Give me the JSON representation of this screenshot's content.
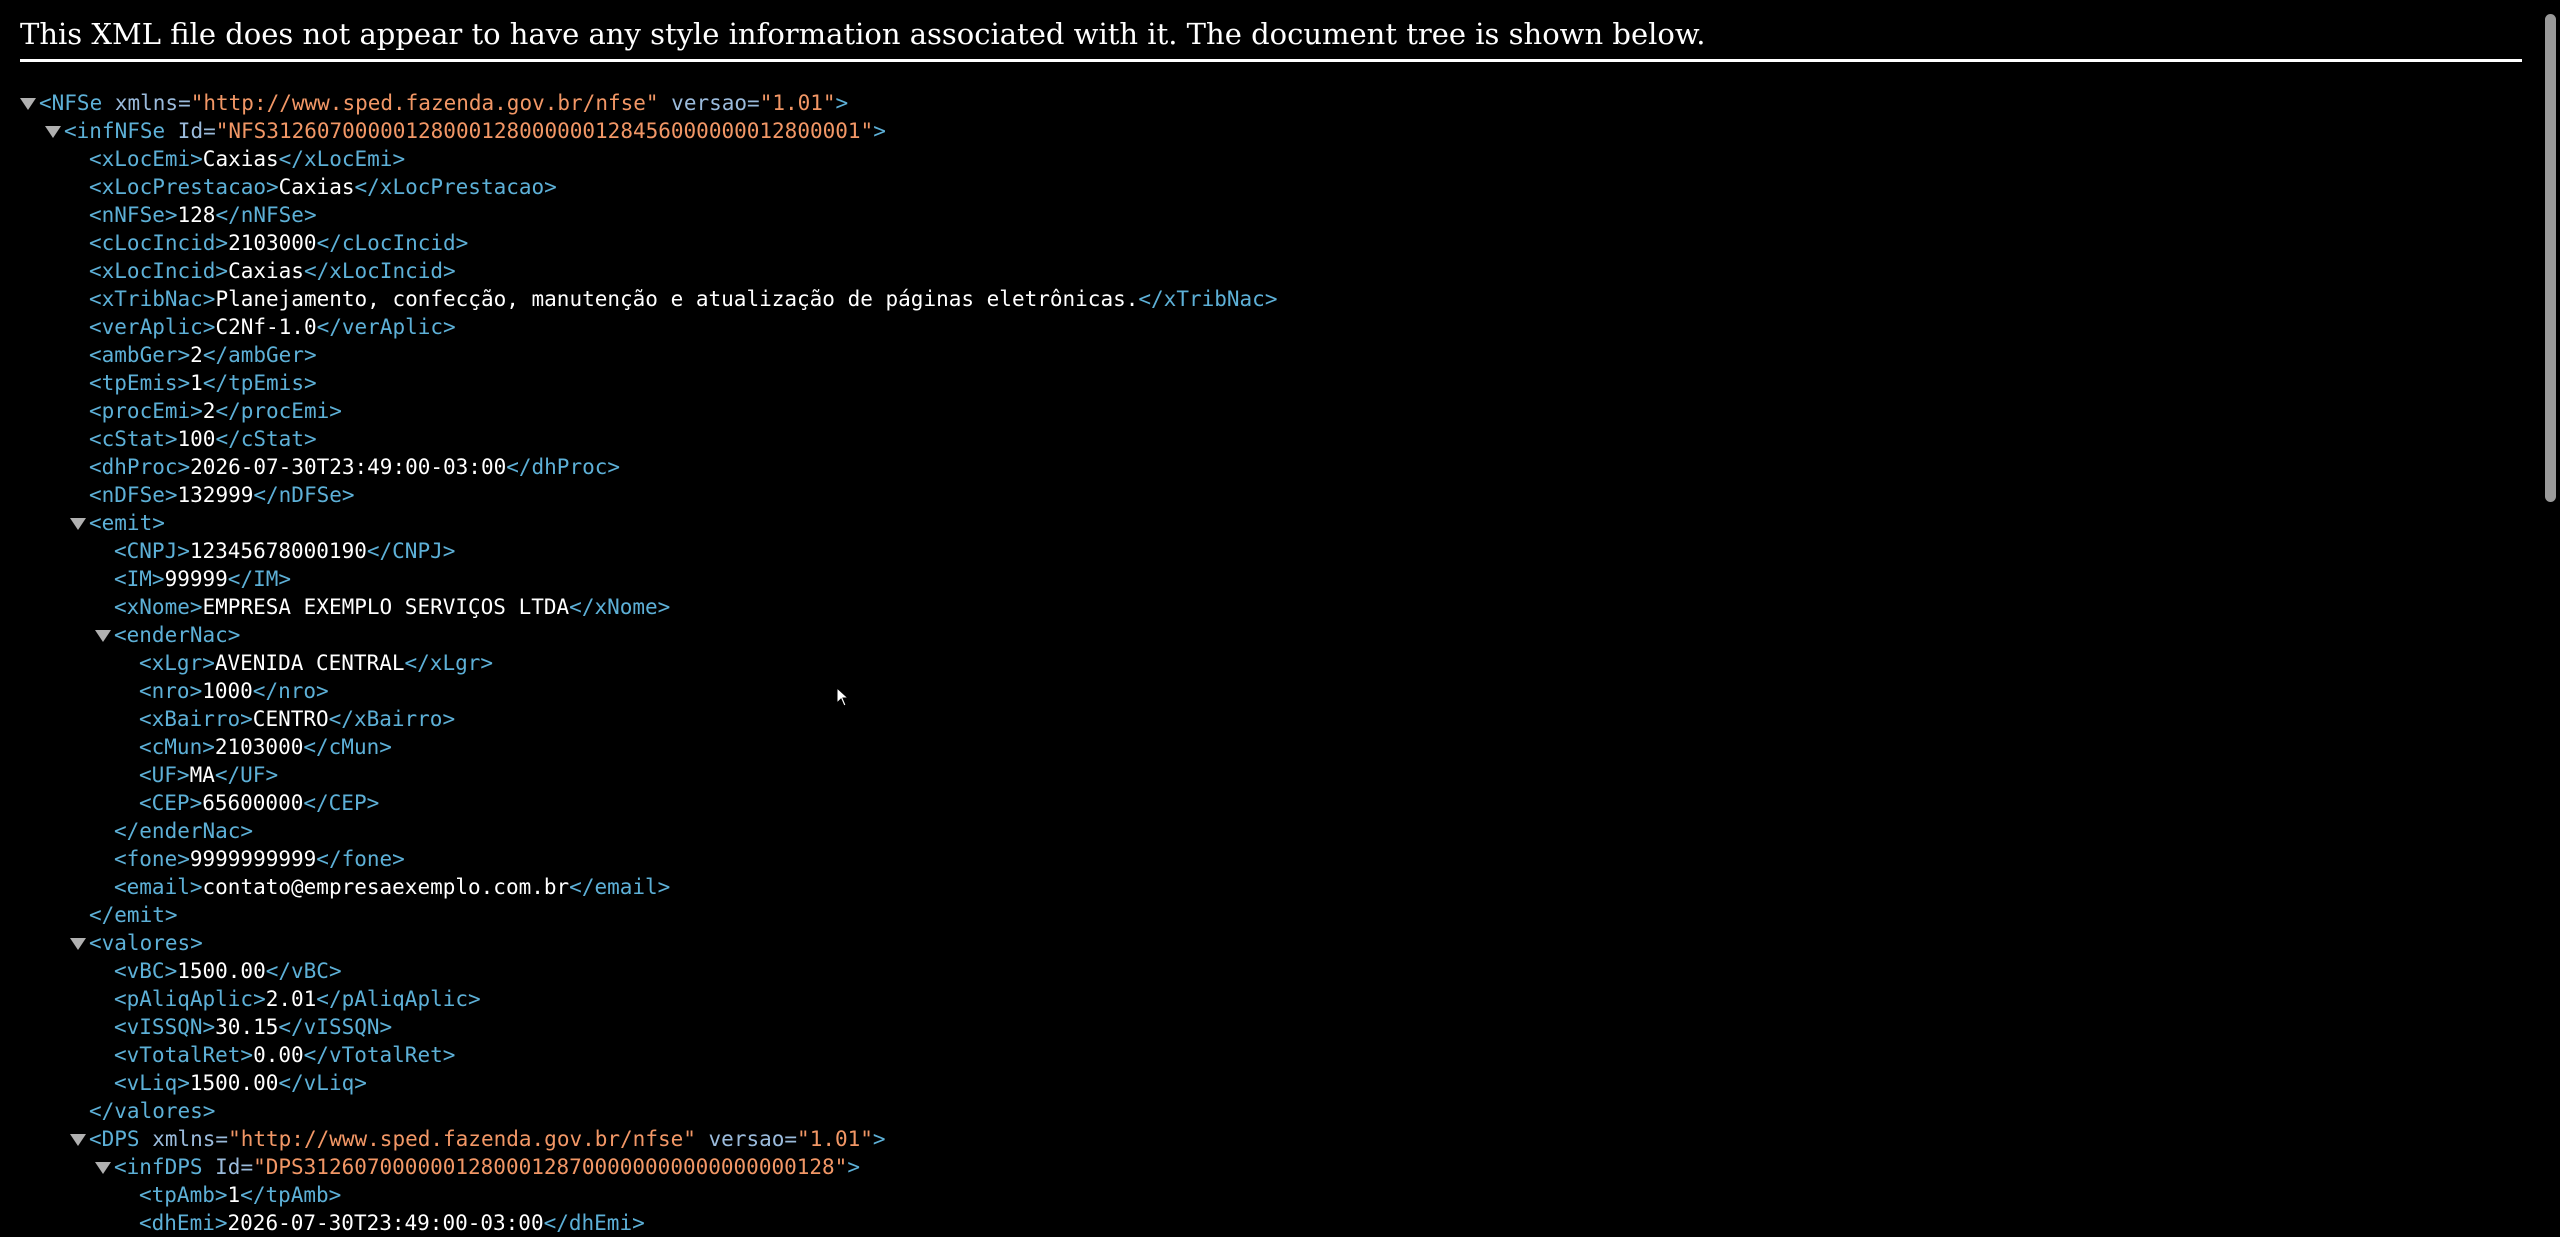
{
  "notice": "This XML file does not appear to have any style information associated with it. The document tree is shown below.",
  "lines": [
    {
      "indent": 0,
      "toggle": true,
      "parts": [
        {
          "t": "tg",
          "v": "<NFSe"
        },
        {
          "t": "an",
          "v": " xmlns="
        },
        {
          "t": "av",
          "v": "\"http://www.sped.fazenda.gov.br/nfse\""
        },
        {
          "t": "an",
          "v": " versao="
        },
        {
          "t": "av",
          "v": "\"1.01\""
        },
        {
          "t": "tg",
          "v": ">"
        }
      ]
    },
    {
      "indent": 1,
      "toggle": true,
      "parts": [
        {
          "t": "tg",
          "v": "<infNFSe"
        },
        {
          "t": "an",
          "v": " Id="
        },
        {
          "t": "av",
          "v": "\"NFS31260700000128000128000000128456000000012800001\""
        },
        {
          "t": "tg",
          "v": ">"
        }
      ]
    },
    {
      "indent": 2,
      "parts": [
        {
          "t": "tg",
          "v": "<xLocEmi>"
        },
        {
          "t": "tx",
          "v": "Caxias"
        },
        {
          "t": "tg",
          "v": "</xLocEmi>"
        }
      ]
    },
    {
      "indent": 2,
      "parts": [
        {
          "t": "tg",
          "v": "<xLocPrestacao>"
        },
        {
          "t": "tx",
          "v": "Caxias"
        },
        {
          "t": "tg",
          "v": "</xLocPrestacao>"
        }
      ]
    },
    {
      "indent": 2,
      "parts": [
        {
          "t": "tg",
          "v": "<nNFSe>"
        },
        {
          "t": "tx",
          "v": "128"
        },
        {
          "t": "tg",
          "v": "</nNFSe>"
        }
      ]
    },
    {
      "indent": 2,
      "parts": [
        {
          "t": "tg",
          "v": "<cLocIncid>"
        },
        {
          "t": "tx",
          "v": "2103000"
        },
        {
          "t": "tg",
          "v": "</cLocIncid>"
        }
      ]
    },
    {
      "indent": 2,
      "parts": [
        {
          "t": "tg",
          "v": "<xLocIncid>"
        },
        {
          "t": "tx",
          "v": "Caxias"
        },
        {
          "t": "tg",
          "v": "</xLocIncid>"
        }
      ]
    },
    {
      "indent": 2,
      "parts": [
        {
          "t": "tg",
          "v": "<xTribNac>"
        },
        {
          "t": "tx",
          "v": "Planejamento, confecção, manutenção e atualização de páginas eletrônicas."
        },
        {
          "t": "tg",
          "v": "</xTribNac>"
        }
      ]
    },
    {
      "indent": 2,
      "parts": [
        {
          "t": "tg",
          "v": "<verAplic>"
        },
        {
          "t": "tx",
          "v": "C2Nf-1.0"
        },
        {
          "t": "tg",
          "v": "</verAplic>"
        }
      ]
    },
    {
      "indent": 2,
      "parts": [
        {
          "t": "tg",
          "v": "<ambGer>"
        },
        {
          "t": "tx",
          "v": "2"
        },
        {
          "t": "tg",
          "v": "</ambGer>"
        }
      ]
    },
    {
      "indent": 2,
      "parts": [
        {
          "t": "tg",
          "v": "<tpEmis>"
        },
        {
          "t": "tx",
          "v": "1"
        },
        {
          "t": "tg",
          "v": "</tpEmis>"
        }
      ]
    },
    {
      "indent": 2,
      "parts": [
        {
          "t": "tg",
          "v": "<procEmi>"
        },
        {
          "t": "tx",
          "v": "2"
        },
        {
          "t": "tg",
          "v": "</procEmi>"
        }
      ]
    },
    {
      "indent": 2,
      "parts": [
        {
          "t": "tg",
          "v": "<cStat>"
        },
        {
          "t": "tx",
          "v": "100"
        },
        {
          "t": "tg",
          "v": "</cStat>"
        }
      ]
    },
    {
      "indent": 2,
      "parts": [
        {
          "t": "tg",
          "v": "<dhProc>"
        },
        {
          "t": "tx",
          "v": "2026-07-30T23:49:00-03:00"
        },
        {
          "t": "tg",
          "v": "</dhProc>"
        }
      ]
    },
    {
      "indent": 2,
      "parts": [
        {
          "t": "tg",
          "v": "<nDFSe>"
        },
        {
          "t": "tx",
          "v": "132999"
        },
        {
          "t": "tg",
          "v": "</nDFSe>"
        }
      ]
    },
    {
      "indent": 2,
      "toggle": true,
      "parts": [
        {
          "t": "tg",
          "v": "<emit>"
        }
      ]
    },
    {
      "indent": 3,
      "parts": [
        {
          "t": "tg",
          "v": "<CNPJ>"
        },
        {
          "t": "tx",
          "v": "12345678000190"
        },
        {
          "t": "tg",
          "v": "</CNPJ>"
        }
      ]
    },
    {
      "indent": 3,
      "parts": [
        {
          "t": "tg",
          "v": "<IM>"
        },
        {
          "t": "tx",
          "v": "99999"
        },
        {
          "t": "tg",
          "v": "</IM>"
        }
      ]
    },
    {
      "indent": 3,
      "parts": [
        {
          "t": "tg",
          "v": "<xNome>"
        },
        {
          "t": "tx",
          "v": "EMPRESA EXEMPLO SERVIÇOS LTDA"
        },
        {
          "t": "tg",
          "v": "</xNome>"
        }
      ]
    },
    {
      "indent": 3,
      "toggle": true,
      "parts": [
        {
          "t": "tg",
          "v": "<enderNac>"
        }
      ]
    },
    {
      "indent": 4,
      "parts": [
        {
          "t": "tg",
          "v": "<xLgr>"
        },
        {
          "t": "tx",
          "v": "AVENIDA CENTRAL"
        },
        {
          "t": "tg",
          "v": "</xLgr>"
        }
      ]
    },
    {
      "indent": 4,
      "parts": [
        {
          "t": "tg",
          "v": "<nro>"
        },
        {
          "t": "tx",
          "v": "1000"
        },
        {
          "t": "tg",
          "v": "</nro>"
        }
      ]
    },
    {
      "indent": 4,
      "parts": [
        {
          "t": "tg",
          "v": "<xBairro>"
        },
        {
          "t": "tx",
          "v": "CENTRO"
        },
        {
          "t": "tg",
          "v": "</xBairro>"
        }
      ]
    },
    {
      "indent": 4,
      "parts": [
        {
          "t": "tg",
          "v": "<cMun>"
        },
        {
          "t": "tx",
          "v": "2103000"
        },
        {
          "t": "tg",
          "v": "</cMun>"
        }
      ]
    },
    {
      "indent": 4,
      "parts": [
        {
          "t": "tg",
          "v": "<UF>"
        },
        {
          "t": "tx",
          "v": "MA"
        },
        {
          "t": "tg",
          "v": "</UF>"
        }
      ]
    },
    {
      "indent": 4,
      "parts": [
        {
          "t": "tg",
          "v": "<CEP>"
        },
        {
          "t": "tx",
          "v": "65600000"
        },
        {
          "t": "tg",
          "v": "</CEP>"
        }
      ]
    },
    {
      "indent": 3,
      "parts": [
        {
          "t": "tg",
          "v": "</enderNac>"
        }
      ]
    },
    {
      "indent": 3,
      "parts": [
        {
          "t": "tg",
          "v": "<fone>"
        },
        {
          "t": "tx",
          "v": "9999999999"
        },
        {
          "t": "tg",
          "v": "</fone>"
        }
      ]
    },
    {
      "indent": 3,
      "parts": [
        {
          "t": "tg",
          "v": "<email>"
        },
        {
          "t": "tx",
          "v": "contato@empresaexemplo.com.br"
        },
        {
          "t": "tg",
          "v": "</email>"
        }
      ]
    },
    {
      "indent": 2,
      "parts": [
        {
          "t": "tg",
          "v": "</emit>"
        }
      ]
    },
    {
      "indent": 2,
      "toggle": true,
      "parts": [
        {
          "t": "tg",
          "v": "<valores>"
        }
      ]
    },
    {
      "indent": 3,
      "parts": [
        {
          "t": "tg",
          "v": "<vBC>"
        },
        {
          "t": "tx",
          "v": "1500.00"
        },
        {
          "t": "tg",
          "v": "</vBC>"
        }
      ]
    },
    {
      "indent": 3,
      "parts": [
        {
          "t": "tg",
          "v": "<pAliqAplic>"
        },
        {
          "t": "tx",
          "v": "2.01"
        },
        {
          "t": "tg",
          "v": "</pAliqAplic>"
        }
      ]
    },
    {
      "indent": 3,
      "parts": [
        {
          "t": "tg",
          "v": "<vISSQN>"
        },
        {
          "t": "tx",
          "v": "30.15"
        },
        {
          "t": "tg",
          "v": "</vISSQN>"
        }
      ]
    },
    {
      "indent": 3,
      "parts": [
        {
          "t": "tg",
          "v": "<vTotalRet>"
        },
        {
          "t": "tx",
          "v": "0.00"
        },
        {
          "t": "tg",
          "v": "</vTotalRet>"
        }
      ]
    },
    {
      "indent": 3,
      "parts": [
        {
          "t": "tg",
          "v": "<vLiq>"
        },
        {
          "t": "tx",
          "v": "1500.00"
        },
        {
          "t": "tg",
          "v": "</vLiq>"
        }
      ]
    },
    {
      "indent": 2,
      "parts": [
        {
          "t": "tg",
          "v": "</valores>"
        }
      ]
    },
    {
      "indent": 2,
      "toggle": true,
      "parts": [
        {
          "t": "tg",
          "v": "<DPS"
        },
        {
          "t": "an",
          "v": " xmlns="
        },
        {
          "t": "av",
          "v": "\"http://www.sped.fazenda.gov.br/nfse\""
        },
        {
          "t": "an",
          "v": " versao="
        },
        {
          "t": "av",
          "v": "\"1.01\""
        },
        {
          "t": "tg",
          "v": ">"
        }
      ]
    },
    {
      "indent": 3,
      "toggle": true,
      "parts": [
        {
          "t": "tg",
          "v": "<infDPS"
        },
        {
          "t": "an",
          "v": " Id="
        },
        {
          "t": "av",
          "v": "\"DPS312607000000128000128700000000000000000128\""
        },
        {
          "t": "tg",
          "v": ">"
        }
      ]
    },
    {
      "indent": 4,
      "parts": [
        {
          "t": "tg",
          "v": "<tpAmb>"
        },
        {
          "t": "tx",
          "v": "1"
        },
        {
          "t": "tg",
          "v": "</tpAmb>"
        }
      ]
    },
    {
      "indent": 4,
      "parts": [
        {
          "t": "tg",
          "v": "<dhEmi>"
        },
        {
          "t": "tx",
          "v": "2026-07-30T23:49:00-03:00"
        },
        {
          "t": "tg",
          "v": "</dhEmi>"
        }
      ]
    }
  ]
}
